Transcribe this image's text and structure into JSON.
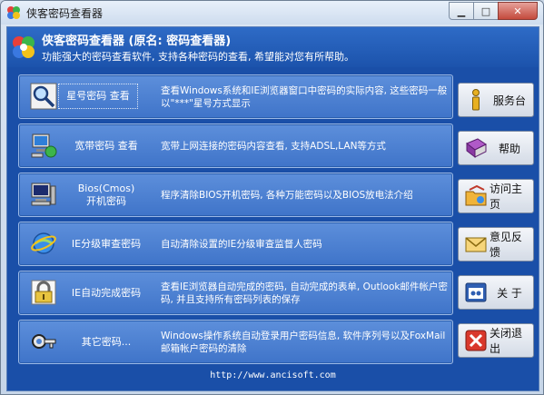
{
  "window": {
    "title": "侠客密码查看器"
  },
  "header": {
    "title": "侠客密码查看器 (原名: 密码查看器)",
    "subtitle": "功能强大的密码查看软件, 支持各种密码的查看, 希望能对您有所帮助。"
  },
  "panels": [
    {
      "label": "星号密码 查看",
      "label2": "",
      "desc": "查看Windows系统和IE浏览器窗口中密码的实际内容, 这些密码一般以\"***\"星号方式显示",
      "icon": "magnifier-icon"
    },
    {
      "label": "宽带密码 查看",
      "label2": "",
      "desc": "宽带上网连接的密码内容查看, 支持ADSL,LAN等方式",
      "icon": "network-computer-icon"
    },
    {
      "label": "Bios(Cmos)",
      "label2": "开机密码",
      "desc": "程序清除BIOS开机密码, 各种万能密码以及BIOS放电法介绍",
      "icon": "computer-icon"
    },
    {
      "label": "IE分级审查密码",
      "label2": "",
      "desc": "自动清除设置的IE分级审查监督人密码",
      "icon": "ie-globe-icon"
    },
    {
      "label": "IE自动完成密码",
      "label2": "",
      "desc": "查看IE浏览器自动完成的密码, 自动完成的表单, Outlook邮件帐户密码, 并且支持所有密码列表的保存",
      "icon": "padlock-icon"
    },
    {
      "label": "其它密码...",
      "label2": "",
      "desc": "Windows操作系统自动登录用户密码信息, 软件序列号以及FoxMail 邮箱帐户密码的清除",
      "icon": "key-icon"
    }
  ],
  "side_buttons": [
    {
      "label": "服务台",
      "icon": "info-icon"
    },
    {
      "label": "帮助",
      "icon": "help-book-icon"
    },
    {
      "label": "访问主页",
      "icon": "home-folder-icon"
    },
    {
      "label": "意见反馈",
      "icon": "mail-icon"
    },
    {
      "label": "关 于",
      "icon": "about-window-icon"
    },
    {
      "label": "关闭退出",
      "icon": "close-x-icon"
    }
  ],
  "footer": {
    "url": "http://www.ancisoft.com"
  },
  "colors": {
    "accent": "#1a4fa8",
    "panel": "#4f84d4"
  }
}
